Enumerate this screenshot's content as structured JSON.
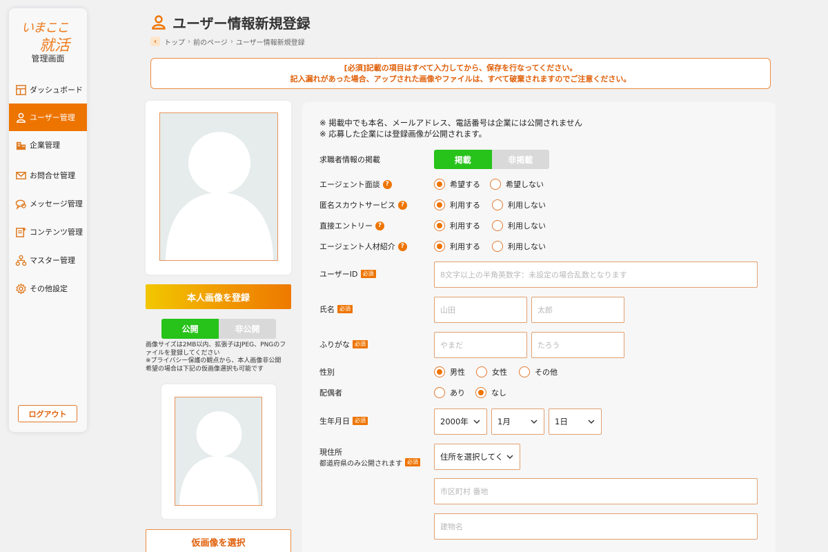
{
  "sidebar": {
    "logo_line1": "いまここ",
    "logo_line2": "就活",
    "admin_title": "管理画面",
    "items": [
      {
        "label": "ダッシュボード",
        "icon": "dashboard-icon"
      },
      {
        "label": "ユーザー管理",
        "icon": "user-icon"
      },
      {
        "label": "企業管理",
        "icon": "building-icon"
      },
      {
        "label": "お問合せ管理",
        "icon": "mail-icon"
      },
      {
        "label": "メッセージ管理",
        "icon": "chat-icon"
      },
      {
        "label": "コンテンツ管理",
        "icon": "document-icon"
      },
      {
        "label": "マスター管理",
        "icon": "hierarchy-icon"
      },
      {
        "label": "その他設定",
        "icon": "gear-icon"
      }
    ],
    "active_index": 1,
    "logout_label": "ログアウト"
  },
  "header": {
    "title": "ユーザー情報新規登録",
    "breadcrumb": [
      "トップ",
      "前のページ",
      "ユーザー情報新規登録"
    ]
  },
  "notice": {
    "line1": "[必須]記載の項目はすべて入力してから、保存を行なってください。",
    "line2": "記入漏れがあった場合、アップされた画像やファイルは、すべて破棄されますのでご注意ください。"
  },
  "photo": {
    "register_label": "本人画像を登録",
    "public_label": "公開",
    "private_label": "非公開",
    "note_lines": [
      "画像サイズは2MB以内、拡張子はJPEG、PNGのフ",
      "ァイルを登録してください",
      "※プライバシー保護の観点から、本人画像非公開",
      "希望の場合は下記の仮画像選択も可能です"
    ],
    "dummy_select_label": "仮画像を選択"
  },
  "form": {
    "privacy_line1": "※ 掲載中でも本名、メールアドレス、電話番号は企業には公開されません",
    "privacy_line2": "※ 応募した企業には登録画像が公開されます。",
    "listing": {
      "label": "求職者情報の掲載",
      "on": "掲載",
      "off": "非掲載"
    },
    "agent_interview": {
      "label": "エージェント面談",
      "opt1": "希望する",
      "opt2": "希望しない"
    },
    "scout": {
      "label": "匿名スカウトサービス",
      "opt1": "利用する",
      "opt2": "利用しない"
    },
    "direct_entry": {
      "label": "直接エントリー",
      "opt1": "利用する",
      "opt2": "利用しない"
    },
    "agent_referral": {
      "label": "エージェント人材紹介",
      "opt1": "利用する",
      "opt2": "利用しない"
    },
    "required_badge": "必須",
    "help_mark": "?",
    "user_id": {
      "label": "ユーザーID",
      "placeholder": "8文字以上の半角英数字：未設定の場合乱数となります"
    },
    "name": {
      "label": "氏名",
      "last_placeholder": "山田",
      "first_placeholder": "太郎"
    },
    "kana": {
      "label": "ふりがな",
      "last_placeholder": "やまだ",
      "first_placeholder": "たろう"
    },
    "gender": {
      "label": "性別",
      "opt1": "男性",
      "opt2": "女性",
      "opt3": "その他"
    },
    "spouse": {
      "label": "配偶者",
      "opt1": "あり",
      "opt2": "なし"
    },
    "birthday": {
      "label": "生年月日",
      "year": "2000年",
      "month": "1月",
      "day": "1日"
    },
    "address": {
      "label": "現住所",
      "sublabel": "都道府県のみ公開されます",
      "pref_select": "住所を選択してく",
      "city_placeholder": "市区町村 番地",
      "building_placeholder": "建物名"
    }
  },
  "colors": {
    "accent": "#ee7400",
    "green": "#27c21a",
    "gray": "#d9d9d9"
  }
}
